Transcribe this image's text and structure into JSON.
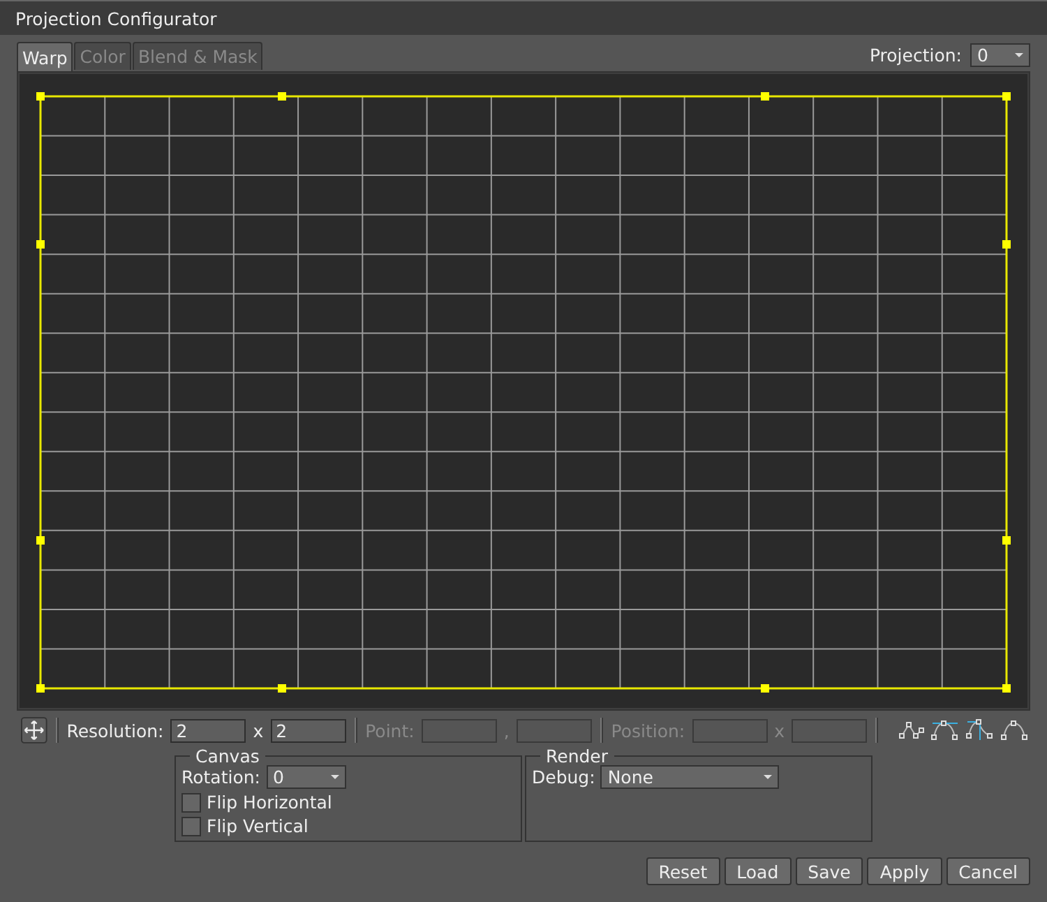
{
  "window": {
    "title": "Projection Configurator"
  },
  "tabs": [
    {
      "label": "Warp",
      "selected": true
    },
    {
      "label": "Color",
      "selected": false
    },
    {
      "label": "Blend & Mask",
      "selected": false
    }
  ],
  "projection": {
    "label": "Projection:",
    "value": "0"
  },
  "toolbar": {
    "fields": [
      {
        "label": "Resolution:",
        "separator": "x",
        "values": [
          "2",
          "2"
        ],
        "disabled": false
      },
      {
        "label": "Point:",
        "separator": ",",
        "disabled": true
      },
      {
        "label": "Position:",
        "separator": "x",
        "disabled": true
      }
    ]
  },
  "canvas_group": {
    "legend": "Canvas",
    "rotation_label": "Rotation:",
    "rotation_value": "0",
    "checkboxes": [
      {
        "label": "Flip Horizontal",
        "checked": false
      },
      {
        "label": "Flip Vertical",
        "checked": false
      }
    ]
  },
  "render_group": {
    "legend": "Render",
    "debug_label": "Debug:",
    "debug_value": "None"
  },
  "buttons": [
    "Reset",
    "Load",
    "Save",
    "Apply",
    "Cancel"
  ]
}
